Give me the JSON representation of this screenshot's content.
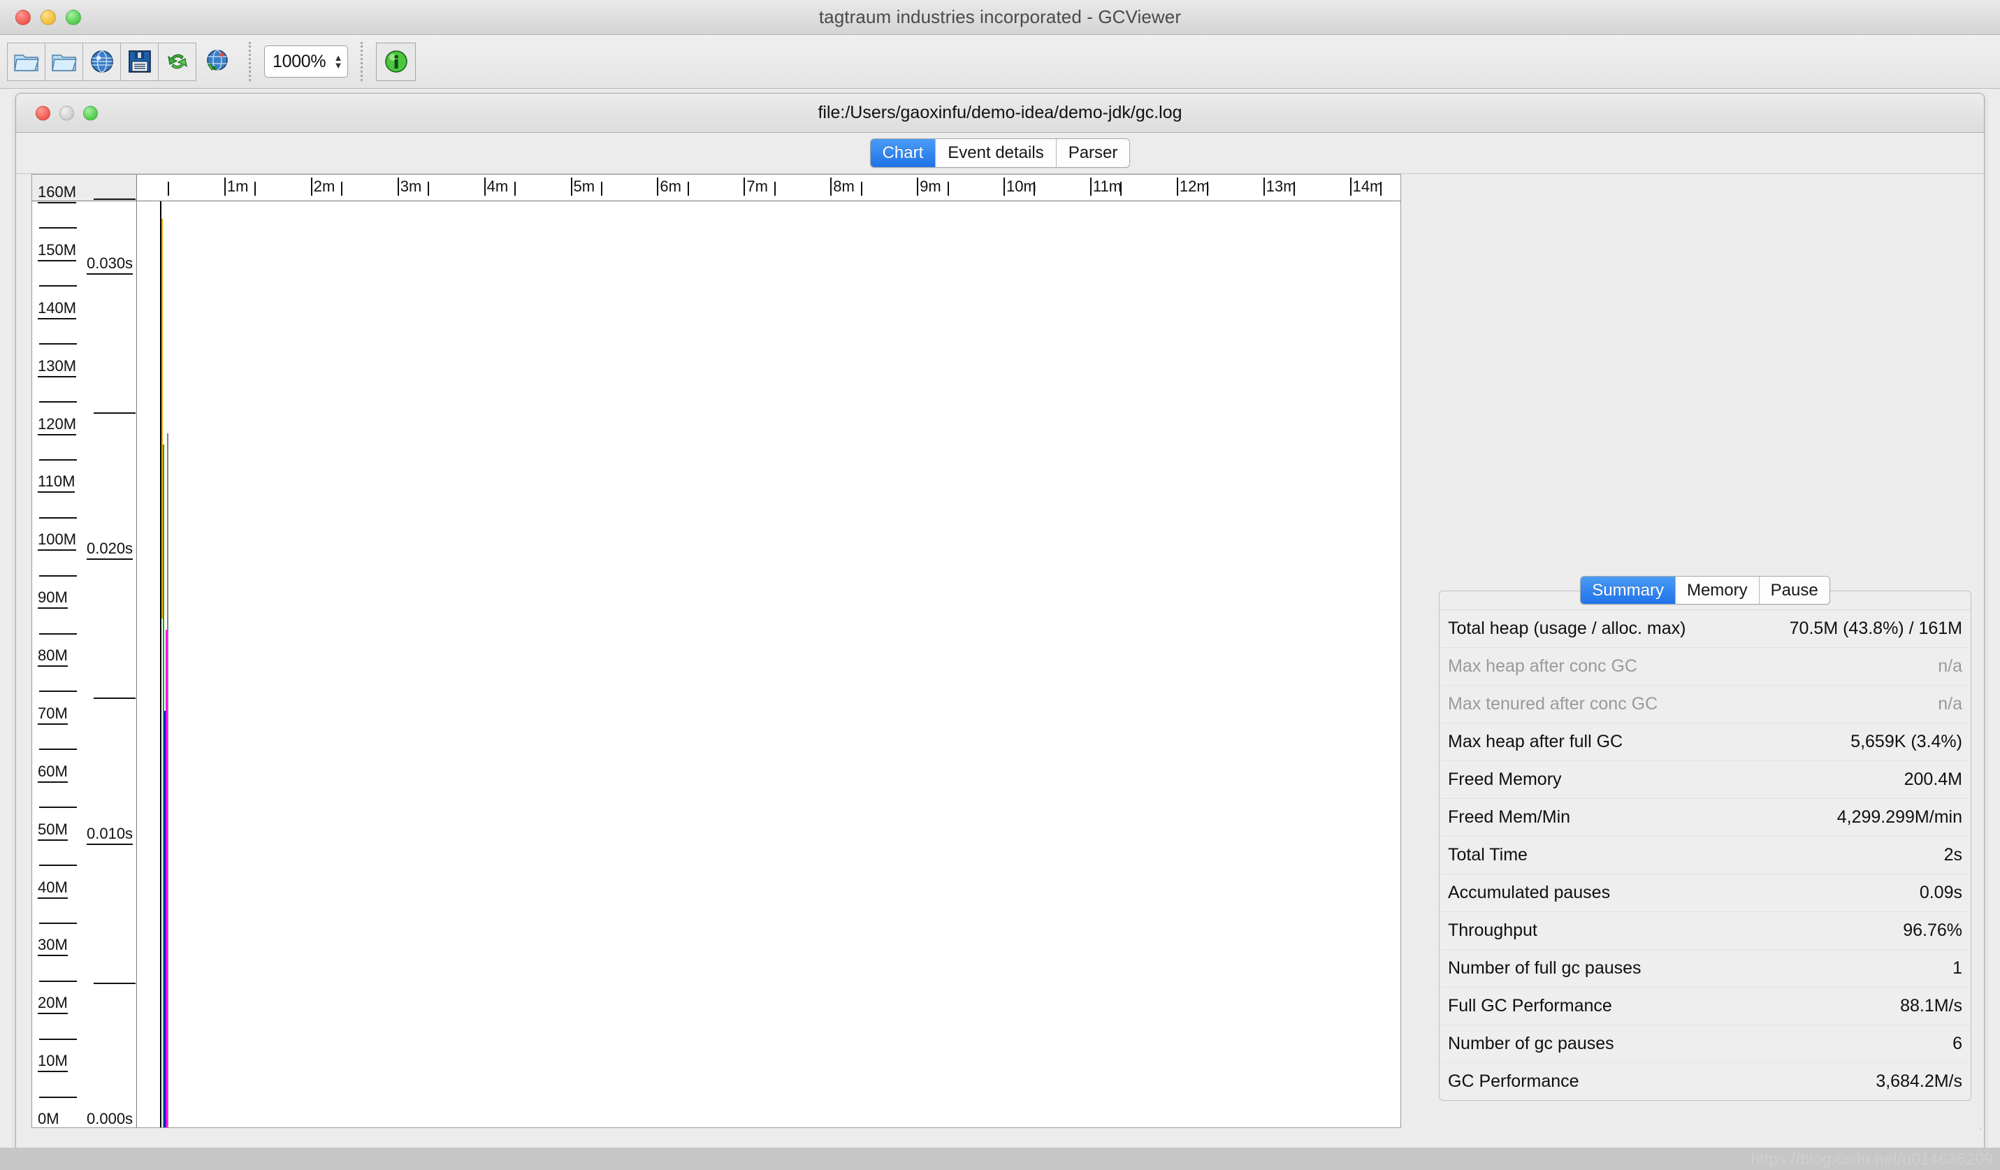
{
  "window": {
    "title": "tagtraum industries incorporated - GCViewer",
    "traffic_lights": [
      "close",
      "minimize",
      "zoom"
    ]
  },
  "toolbar": {
    "buttons": [
      {
        "name": "open-file-button",
        "icon": "open-folder-icon"
      },
      {
        "name": "open-recent-button",
        "icon": "open-folder-icon"
      },
      {
        "name": "open-url-button",
        "icon": "globe-icon"
      },
      {
        "name": "save-button",
        "icon": "floppy-disk-icon"
      },
      {
        "name": "refresh-button",
        "icon": "refresh-arrows-icon"
      },
      {
        "name": "watch-button",
        "icon": "globe-refresh-icon"
      }
    ],
    "zoom": {
      "value": "1000%",
      "label": "zoom-spinner"
    },
    "info": {
      "name": "about-button",
      "icon": "info-icon"
    }
  },
  "document_window": {
    "title": "file:/Users/gaoxinfu/demo-idea/demo-jdk/gc.log",
    "traffic_lights": [
      "close",
      "minimize-disabled",
      "zoom"
    ],
    "tabs": [
      {
        "label": "Chart",
        "active": true
      },
      {
        "label": "Event details",
        "active": false
      },
      {
        "label": "Parser",
        "active": false
      }
    ]
  },
  "chart_data": {
    "type": "line",
    "title": "",
    "xlabel": "",
    "ylabel": "",
    "y2label": "",
    "grid": false,
    "legend": "none",
    "x_ticks": [
      "1m",
      "2m",
      "3m",
      "4m",
      "5m",
      "6m",
      "7m",
      "8m",
      "9m",
      "10m",
      "11m",
      "12m",
      "13m",
      "14m"
    ],
    "x_minor_ticks_between": 1,
    "xlim": [
      "0m",
      "14.6m"
    ],
    "y_left_axis": {
      "label_suffix": "M",
      "ticks": [
        "160M",
        "150M",
        "140M",
        "130M",
        "120M",
        "110M",
        "100M",
        "90M",
        "80M",
        "70M",
        "60M",
        "50M",
        "40M",
        "30M",
        "20M",
        "10M",
        "0M"
      ],
      "ylim": [
        0,
        160
      ],
      "minor_tick_step": 5
    },
    "y_right_axis": {
      "label_suffix": "s",
      "ticks": [
        "0.030s",
        "0.020s",
        "0.010s",
        "0.000s"
      ],
      "ylim": [
        0.0,
        0.0325
      ],
      "minor_ticks": [
        "0.0325s",
        "0.025s",
        "0.015s",
        "0.005s"
      ]
    },
    "series": [
      {
        "name": "total heap",
        "color": "#000000",
        "x": 0.02,
        "y_top": 160,
        "y_bottom": 0
      },
      {
        "name": "tenured",
        "color": "#FFA500",
        "x": 0.02,
        "y_top": 157,
        "y_bottom": 88
      },
      {
        "name": "young",
        "color": "#00AA00",
        "x": 0.02,
        "y_top": 118,
        "y_bottom": 0
      },
      {
        "name": "used heap",
        "color": "#0000EE",
        "x": 0.02,
        "y_top": 72,
        "y_bottom": 0
      },
      {
        "name": "gc times",
        "color": "#FF00FF",
        "x": 0.02,
        "y_top": 86,
        "y_bottom": 0
      },
      {
        "name": "full gc lines",
        "color": "#808080",
        "x": 0.02,
        "y_top": 120,
        "y_bottom": 0
      }
    ],
    "note": "At 1000% zoom all 6 gc events are compressed into a narrow vertical band at the left edge of the plot."
  },
  "summary_panel": {
    "tabs": [
      {
        "label": "Summary",
        "active": true
      },
      {
        "label": "Memory",
        "active": false
      },
      {
        "label": "Pause",
        "active": false
      }
    ],
    "rows": [
      {
        "key": "Total heap (usage / alloc. max)",
        "value": "70.5M (43.8%) / 161M",
        "dim": false
      },
      {
        "key": "Max heap after conc GC",
        "value": "n/a",
        "dim": true
      },
      {
        "key": "Max tenured after conc GC",
        "value": "n/a",
        "dim": true
      },
      {
        "key": "Max heap after full GC",
        "value": "5,659K (3.4%)",
        "dim": false
      },
      {
        "key": "Freed Memory",
        "value": "200.4M",
        "dim": false
      },
      {
        "key": "Freed Mem/Min",
        "value": "4,299.299M/min",
        "dim": false
      },
      {
        "key": "Total Time",
        "value": "2s",
        "dim": false
      },
      {
        "key": "Accumulated pauses",
        "value": "0.09s",
        "dim": false
      },
      {
        "key": "Throughput",
        "value": "96.76%",
        "dim": false
      },
      {
        "key": "Number of full gc pauses",
        "value": "1",
        "dim": false
      },
      {
        "key": "Full GC Performance",
        "value": "88.1M/s",
        "dim": false
      },
      {
        "key": "Number of gc pauses",
        "value": "6",
        "dim": false
      },
      {
        "key": "GC Performance",
        "value": "3,684.2M/s",
        "dim": false
      }
    ]
  },
  "watermark": {
    "text": "https://blog.csdn.net/u014636209"
  },
  "colors": {
    "accent_blue": "#1f73e8",
    "window_bg": "#ececec",
    "plot_bg": "#ffffff",
    "tenured": "#FFA500",
    "young": "#00AA00",
    "used_heap": "#0000EE",
    "total_heap": "#000000",
    "gc_times": "#FF00FF"
  }
}
